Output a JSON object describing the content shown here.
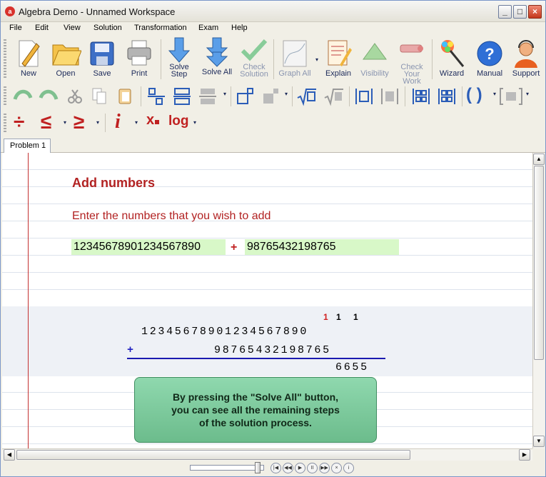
{
  "window": {
    "title": "Algebra Demo - Unnamed Workspace"
  },
  "menu": [
    "File",
    "Edit",
    "View",
    "Solution",
    "Transformation",
    "Exam",
    "Help"
  ],
  "toolbar": {
    "new": "New",
    "open": "Open",
    "save": "Save",
    "print": "Print",
    "solve_step_1": "Solve",
    "solve_step_2": "Step",
    "solve_all": "Solve All",
    "check_solution_1": "Check",
    "check_solution_2": "Solution",
    "graph_all": "Graph All",
    "explain": "Explain",
    "visibility": "Visibility",
    "check_work_1": "Check",
    "check_work_2": "Your Work",
    "wizard": "Wizard",
    "manual": "Manual",
    "support": "Support"
  },
  "symbols": {
    "divide": "÷",
    "leq": "≤",
    "geq": "≥",
    "imag": "i",
    "subscript": "x",
    "log": "log",
    "parens": "( )"
  },
  "tab": {
    "label": "Problem 1"
  },
  "problem": {
    "heading": "Add numbers",
    "prompt": "Enter the numbers that you wish to add",
    "number_a": "12345678901234567890",
    "operator": "+",
    "number_b": "98765432198765"
  },
  "work": {
    "carry_red": "1",
    "carry_black": "1 1",
    "row1": "12345678901234567890",
    "op": "+",
    "row2": "98765432198765",
    "result": "6655"
  },
  "tip": {
    "line1": "By pressing the \"Solve All\" button,",
    "line2": "you can see all the remaining steps",
    "line3": "of the solution process."
  },
  "colors": {
    "accent_red": "#b22222",
    "input_green": "#d8f8c8",
    "tip_green": "#7ccb9a",
    "sum_line": "#1a1ab0"
  },
  "icons": [
    "new-icon",
    "open-icon",
    "save-icon",
    "print-icon",
    "solve-step-icon",
    "solve-all-icon",
    "check-solution-icon",
    "graph-all-icon",
    "explain-icon",
    "visibility-icon",
    "check-work-icon",
    "wizard-icon",
    "manual-icon",
    "support-icon"
  ]
}
